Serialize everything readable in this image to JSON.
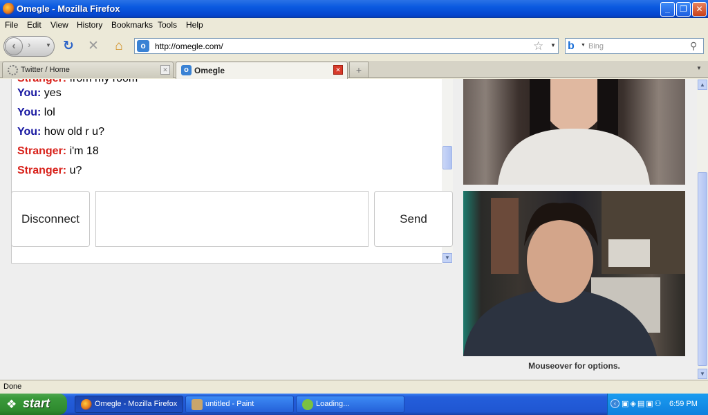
{
  "window": {
    "title": "Omegle - Mozilla Firefox",
    "minimize": "_",
    "maximize": "❐",
    "close": "✕"
  },
  "menu": [
    "File",
    "Edit",
    "View",
    "History",
    "Bookmarks",
    "Tools",
    "Help"
  ],
  "nav": {
    "url": "http://omegle.com/",
    "search_placeholder": "Bing",
    "icons": [
      "back-icon",
      "forward-icon",
      "reload-icon",
      "stop-icon",
      "home-icon",
      "bookmark-star-icon",
      "search-go-icon"
    ]
  },
  "tabs": [
    {
      "label": "Twitter / Home",
      "active": false
    },
    {
      "label": "Omegle",
      "active": true
    }
  ],
  "chat": {
    "lines": [
      {
        "who": "You:",
        "role": "you",
        "text": " yes"
      },
      {
        "who": "You:",
        "role": "you",
        "text": " lol"
      },
      {
        "who": "You:",
        "role": "you",
        "text": " how old r u?"
      },
      {
        "who": "Stranger:",
        "role": "stranger",
        "text": " i'm 18"
      },
      {
        "who": "Stranger:",
        "role": "stranger",
        "text": " u?"
      }
    ],
    "partial_line": {
      "who": "Stranger:",
      "text": " from my room"
    }
  },
  "controls": {
    "disconnect": "Disconnect",
    "send": "Send",
    "message_value": ""
  },
  "video": {
    "caption": "Mouseover for options."
  },
  "status": "Done",
  "taskbar": {
    "start": "start",
    "items": [
      {
        "label": "Omegle - Mozilla Firefox",
        "active": true
      },
      {
        "label": "untitled - Paint",
        "active": false
      },
      {
        "label": "Loading...",
        "active": false
      }
    ],
    "clock": "6:59 PM"
  }
}
